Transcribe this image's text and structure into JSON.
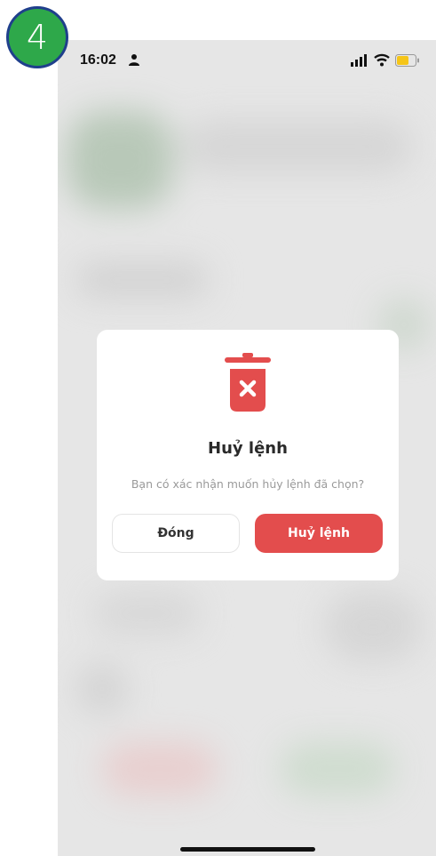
{
  "step_badge": {
    "number": "4",
    "color": "#2ea84a",
    "border_color": "#1f3f8c"
  },
  "status_bar": {
    "time": "16:02",
    "icons": [
      "person-icon",
      "signal-icon",
      "wifi-icon",
      "battery-icon"
    ],
    "battery_color": "#f5c518"
  },
  "dialog": {
    "icon": "trash-delete-icon",
    "title": "Huỷ lệnh",
    "message": "Bạn có xác nhận muốn hủy lệnh đã chọn?",
    "close_label": "Đóng",
    "confirm_label": "Huỷ lệnh",
    "accent_color": "#e34d4d"
  }
}
